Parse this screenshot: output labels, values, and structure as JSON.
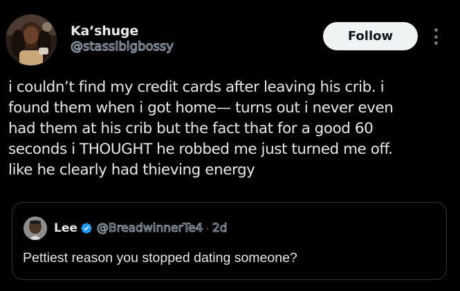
{
  "colors": {
    "background": "#000000",
    "text_primary": "#e7e9ea",
    "text_secondary": "#71767b",
    "verified": "#1d9bf0",
    "follow_bg": "#eff3f4",
    "border": "#2f3336"
  },
  "author": {
    "display_name": "Ka’shuge",
    "handle": "@stassibigbossy",
    "avatar_icon": "profile-photo"
  },
  "actions": {
    "follow_label": "Follow",
    "more_icon": "vertical-dots-icon"
  },
  "tweet": {
    "lines": [
      "i couldn’t find my credit cards after leaving his crib. i",
      "found them when i got home— turns out i never even",
      "had them at his crib but the fact that for a good 60",
      "seconds i THOUGHT he robbed me just turned me off.",
      "like he clearly had thieving energy"
    ]
  },
  "quote": {
    "display_name": "Lee",
    "verified_icon": "verified-badge-icon",
    "handle": "@BreadwinnerTe4",
    "separator": "·",
    "time": "2d",
    "text": "Pettiest reason you stopped dating someone?"
  }
}
